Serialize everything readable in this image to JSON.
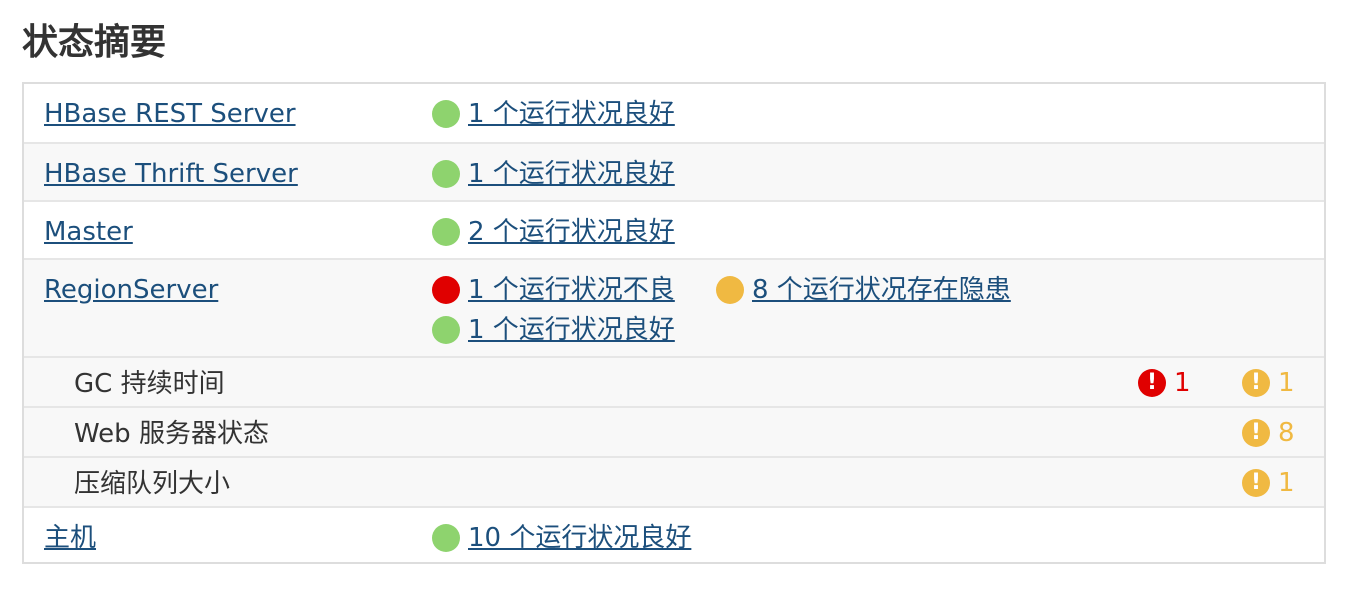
{
  "page": {
    "title": "状态摘要"
  },
  "colors": {
    "good": "#8ed36e",
    "bad": "#e00000",
    "concerning": "#f0b942",
    "link": "#1c4f7c"
  },
  "rows": {
    "rest": {
      "name": "HBase REST Server",
      "status_good": "1 个运行状况良好"
    },
    "thrift": {
      "name": "HBase Thrift Server",
      "status_good": "1 个运行状况良好"
    },
    "master": {
      "name": "Master",
      "status_good": "2 个运行状况良好"
    },
    "regionserver": {
      "name": "RegionServer",
      "status_bad": "1 个运行状况不良",
      "status_concerning": "8 个运行状况存在隐患",
      "status_good": "1 个运行状况良好",
      "subitems": [
        {
          "label": "GC 持续时间",
          "bad_count": "1",
          "concerning_count": "1"
        },
        {
          "label": "Web 服务器状态",
          "concerning_count": "8"
        },
        {
          "label": "压缩队列大小",
          "concerning_count": "1"
        }
      ]
    },
    "hosts": {
      "name": "主机",
      "status_good": "10 个运行状况良好"
    }
  },
  "icons": {
    "good": "green-circle-icon",
    "bad": "red-circle-icon",
    "concerning": "yellow-circle-icon",
    "alert_bad": "red-exclamation-icon",
    "alert_concerning": "yellow-exclamation-icon"
  }
}
